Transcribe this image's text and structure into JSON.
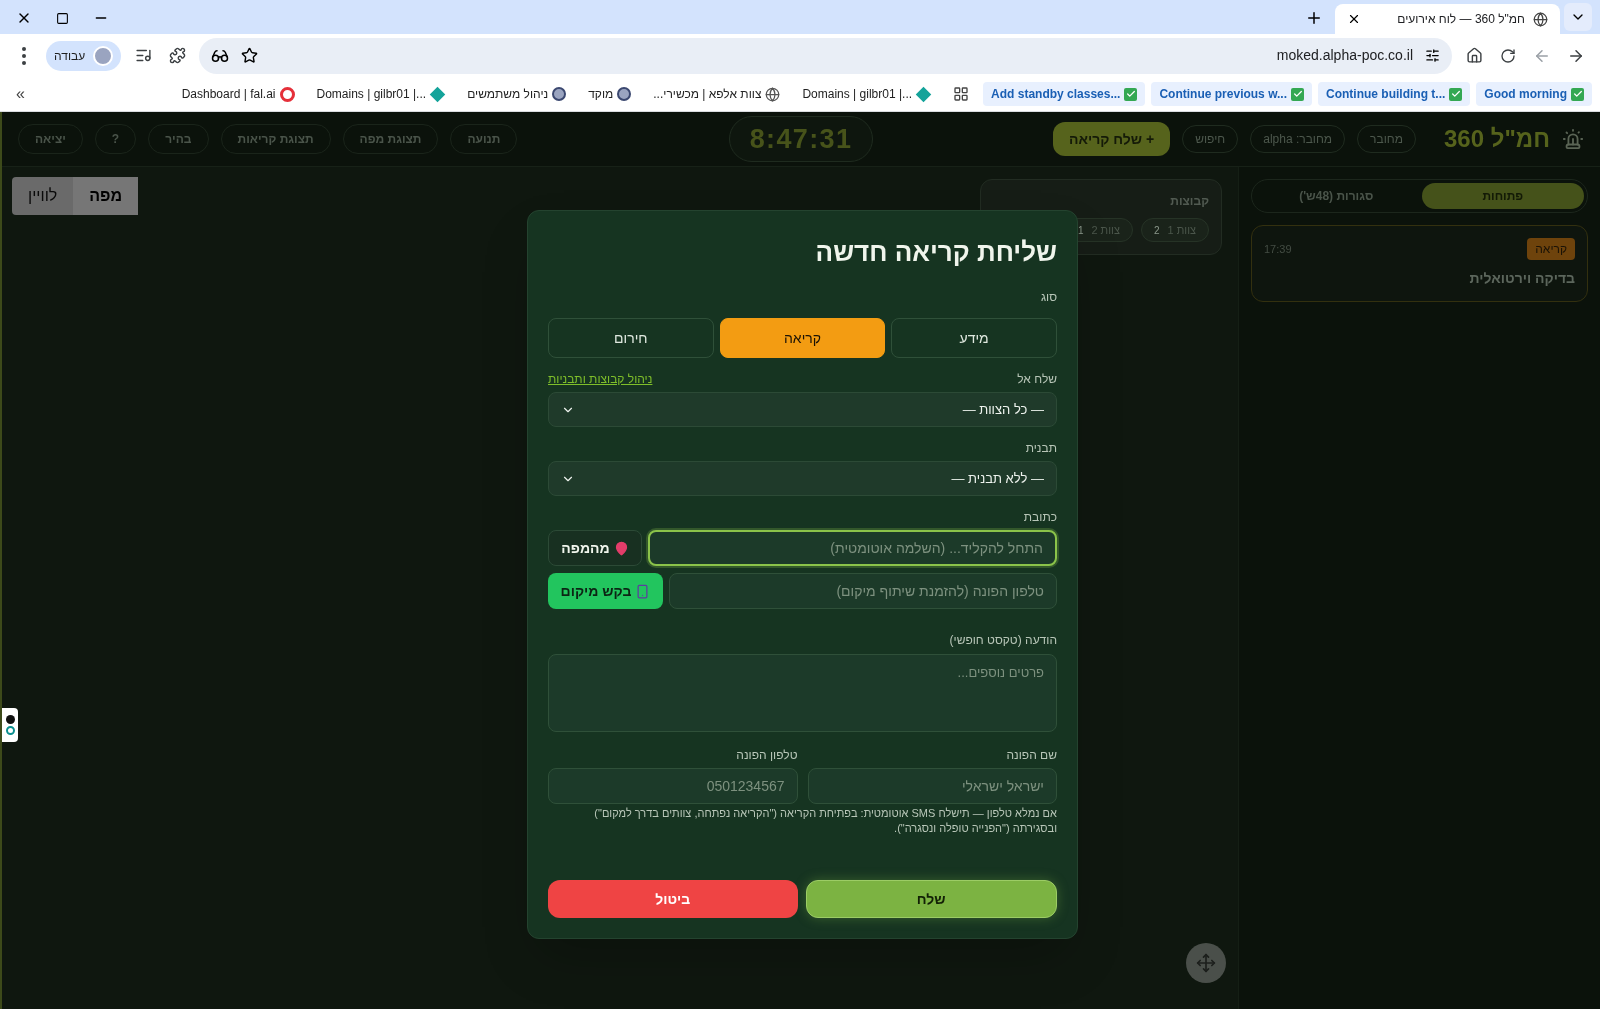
{
  "browser": {
    "tabs": [
      {
        "title": "חמ\"ל 360 — לוח אירועים",
        "selected": true
      }
    ],
    "url": "moked.alpha-poc.co.il",
    "profile": "עבודה",
    "bookmarks": [
      {
        "label": "Good morning",
        "kind": "check"
      },
      {
        "label": "Continue building t...",
        "kind": "check"
      },
      {
        "label": "Continue previous w...",
        "kind": "check"
      },
      {
        "label": "Add standby classes...",
        "kind": "check"
      },
      {
        "label": "Domains | gilbr01 |...",
        "kind": "diamond"
      },
      {
        "label": "צוות אלפא | מכשירי...",
        "kind": "globe"
      },
      {
        "label": "מוקד",
        "kind": "avatar"
      },
      {
        "label": "ניהול משתמשים",
        "kind": "avatar"
      },
      {
        "label": "Domains | gilbr01 |...",
        "kind": "diamond"
      },
      {
        "label": "Dashboard | fal.ai",
        "kind": "ring"
      }
    ],
    "more": "»"
  },
  "header": {
    "title": "חמ\"ל 360",
    "chips": [
      "מחובר",
      "מחובר: alpha",
      "חיפוש"
    ],
    "new_call": "+ שלח קריאה",
    "clock": "8:47:31",
    "nav": [
      "תנועה",
      "תצוגת מפה",
      "תצוגת קריאות",
      "בהיר",
      "?",
      "יציאה"
    ]
  },
  "sidebar": {
    "tabs": [
      {
        "label": "פתוחות",
        "selected": true
      },
      {
        "label": "סגורות (48ש')",
        "selected": false
      }
    ],
    "cards": [
      {
        "badge": "קריאה",
        "time": "17:39",
        "title": "בדיקה וירטואלית"
      }
    ]
  },
  "map": {
    "layers": [
      {
        "label": "מפה",
        "selected": true
      },
      {
        "label": "לוויין",
        "selected": false
      }
    ],
    "groups": {
      "title": "קבוצות",
      "chips": [
        {
          "name": "צוות 1",
          "count": "2"
        },
        {
          "name": "צוות 2",
          "count": "1"
        }
      ]
    }
  },
  "modal": {
    "title": "שליחת קריאה חדשה",
    "type_label": "סוג",
    "types": [
      {
        "label": "מידע",
        "selected": false
      },
      {
        "label": "קריאה",
        "selected": true
      },
      {
        "label": "חירום",
        "selected": false
      }
    ],
    "send_to": {
      "label": "שלח אל",
      "link": "ניהול קבוצות ותבניות",
      "value": "— כל הצוות —"
    },
    "template": {
      "label": "תבנית",
      "value": "— ללא תבנית —"
    },
    "address": {
      "label": "כתובת",
      "placeholder": "התחל להקליד... (השלמה אוטומטית)",
      "focused": true,
      "button": "מהמפה"
    },
    "location": {
      "placeholder": "טלפון הפונה (להזמנת שיתוף מיקום)",
      "button": "בקש מיקום"
    },
    "message": {
      "label": "הודעה (טקסט חופשי)",
      "placeholder": "פרטים נוספים..."
    },
    "caller_name": {
      "label": "שם הפונה",
      "placeholder": "ישראל ישראלי"
    },
    "caller_phone": {
      "label": "טלפון הפונה",
      "placeholder": "0501234567"
    },
    "note": "אם נמלא טלפון — תישלח SMS אוטומטית: בפתיחת הקריאה (\"הקריאה נפתחה, צוותים בדרך למקום\") ובסגירתה (\"הפנייה טופלה ונסגרה\").",
    "buttons": [
      {
        "label": "שלח",
        "kind": "primary"
      },
      {
        "label": "ביטול",
        "kind": "danger"
      }
    ]
  }
}
